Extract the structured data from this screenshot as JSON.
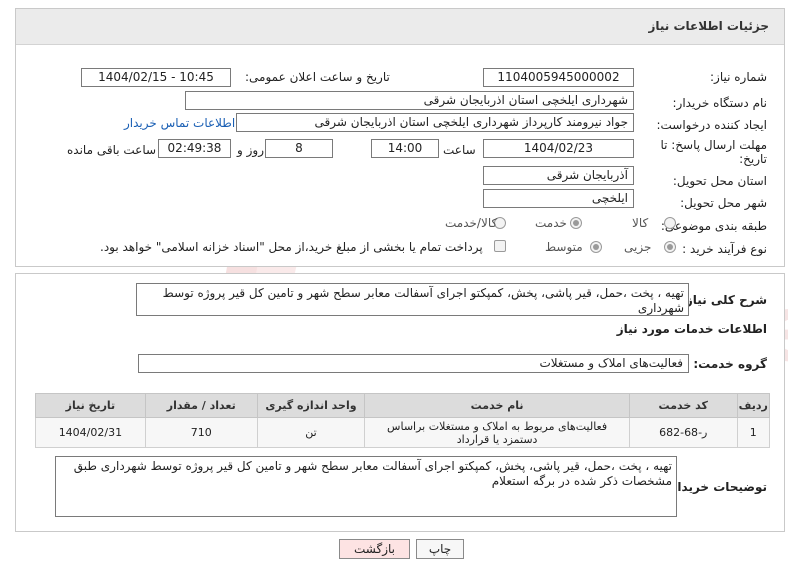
{
  "header": {
    "title": "جزئیات اطلاعات نیاز"
  },
  "fields": {
    "need_number_label": "شماره نیاز:",
    "need_number": "1104005945000002",
    "announce_label": "تاریخ و ساعت اعلان عمومی:",
    "announce_value": "1404/02/15 - 10:45",
    "buyer_org_label": "نام دستگاه خریدار:",
    "buyer_org": "شهرداری ایلخچی استان اذربایجان شرقی",
    "creator_label": "ایجاد کننده درخواست:",
    "creator": "جواد نیرومند کارپرداز شهرداری ایلخچی استان اذربایجان شرقی",
    "contact_link": "اطلاعات تماس خریدار",
    "deadline_label_1": "مهلت ارسال پاسخ: تا",
    "deadline_label_2": "تاریخ:",
    "deadline_date": "1404/02/23",
    "time_label": "ساعت",
    "deadline_time": "14:00",
    "days_value": "8",
    "days_label": "روز و",
    "remaining_value": "02:49:38",
    "remaining_label": "ساعت باقی مانده",
    "province_label": "استان محل تحویل:",
    "province": "آذربایجان شرقی",
    "city_label": "شهر محل تحویل:",
    "city": "ایلخچی",
    "category_label": "طبقه بندی موضوعی:",
    "category_options": [
      "کالا",
      "خدمت",
      "کالا/خدمت"
    ],
    "category_selected": "خدمت",
    "process_label": "نوع فرآیند خرید :",
    "process_options": [
      "جزیی",
      "متوسط"
    ],
    "process_selected": "جزیی",
    "payment_note": "پرداخت تمام یا بخشی از مبلغ خرید،از محل \"اسناد خزانه اسلامی\" خواهد بود."
  },
  "summary": {
    "label": "شرح کلی نیاز:",
    "text": "تهیه ، پخت ،حمل، قیر پاشی، پخش، کمپکتو اجرای آسفالت معابر سطح شهر و تامین کل قیر پروژه توسط شهرداری"
  },
  "services": {
    "section_title": "اطلاعات خدمات مورد نیاز",
    "group_label": "گروه خدمت:",
    "group_value": "فعالیت‌های  املاک و مستغلات",
    "columns": [
      "ردیف",
      "کد خدمت",
      "نام خدمت",
      "واحد اندازه گیری",
      "تعداد / مقدار",
      "تاریخ نیاز"
    ],
    "rows": [
      {
        "index": "1",
        "code": "ر-68-682",
        "name": "فعالیت‌های مربوط به املاک و مستغلات براساس دستمزد یا قرارداد",
        "unit": "تن",
        "quantity": "710",
        "date": "1404/02/31"
      }
    ]
  },
  "buyer_notes": {
    "label": "توضیحات خریدار:",
    "text": "تهیه ، پخت ،حمل، قیر پاشی، پخش، کمپکتو اجرای آسفالت معابر سطح شهر و تامین کل قیر پروژه توسط شهرداری طبق مشخصات ذکر شده در برگه استعلام"
  },
  "buttons": {
    "print": "چاپ",
    "back": "بازگشت"
  },
  "watermark": {
    "text": "AriaTender.neT"
  },
  "colors": {
    "link": "#1a5fb4",
    "header_bg": "#ebebeb",
    "back_button_bg": "#fde3e3",
    "watermark": "#f0c8c8"
  }
}
